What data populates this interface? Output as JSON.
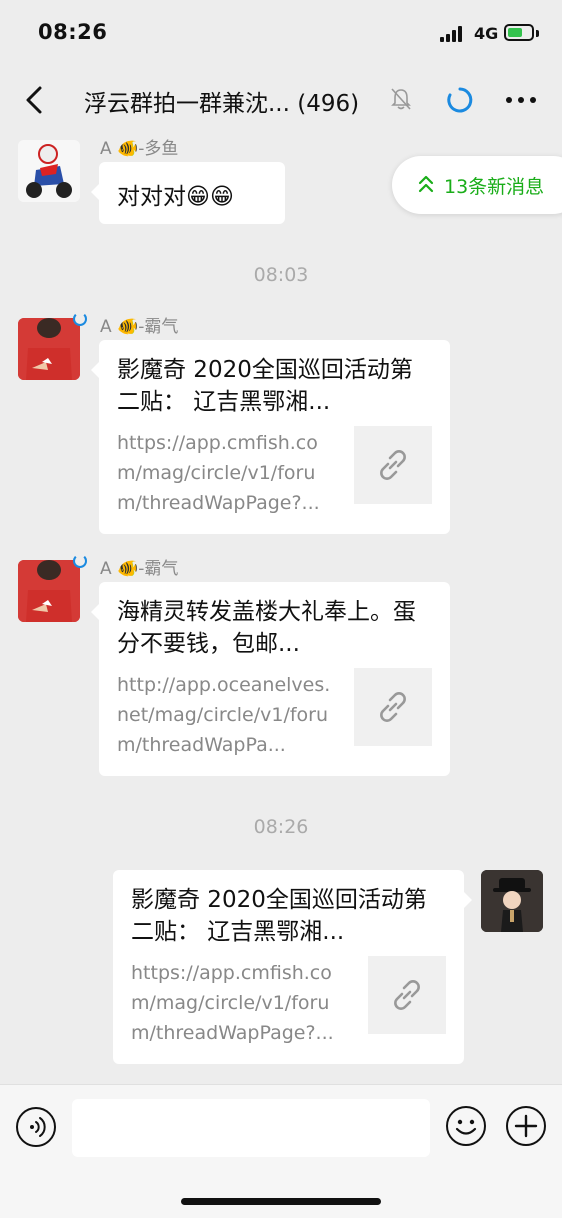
{
  "status_bar": {
    "time": "08:26",
    "network": "4G"
  },
  "nav": {
    "title": "浮云群拍一群兼沈... (496)"
  },
  "new_messages": {
    "label": "13条新消息"
  },
  "messages": [
    {
      "sender": "A 🐠-多鱼",
      "text": "对对对😁😁"
    },
    {
      "time": "08:03"
    },
    {
      "sender": "A 🐠-霸气",
      "title": "影魔奇 2020全国巡回活动第二贴： 辽吉黑鄂湘...",
      "url": "https://app.cmfish.com/mag/circle/v1/forum/threadWapPage?..."
    },
    {
      "sender": "A 🐠-霸气",
      "title": "海精灵转发盖楼大礼奉上。蛋分不要钱，包邮...",
      "url": "http://app.oceanelves.net/mag/circle/v1/forum/threadWapPa..."
    },
    {
      "time": "08:26"
    },
    {
      "sender": "",
      "title": "影魔奇 2020全国巡回活动第二贴： 辽吉黑鄂湘...",
      "url": "https://app.cmfish.com/mag/circle/v1/forum/threadWapPage?..."
    }
  ],
  "input": {
    "value": ""
  },
  "colors": {
    "accent_green": "#1aad19",
    "background": "#ededed",
    "badge_blue": "#1b8ae0"
  }
}
